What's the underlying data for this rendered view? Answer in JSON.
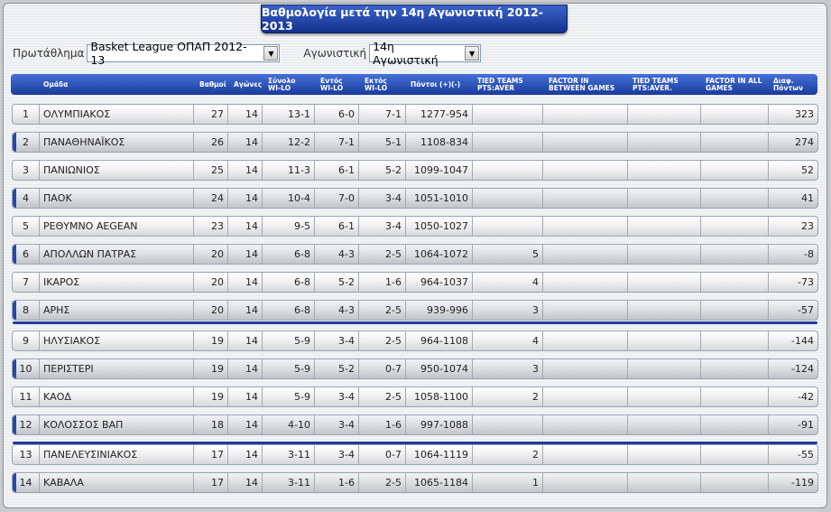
{
  "title": "Βαθμολογία μετά την 14η Αγωνιστική 2012-2013",
  "filters": {
    "league_label": "Πρωτάθλημα",
    "league_value": "Basket League ΟΠΑΠ 2012-13",
    "round_label": "Αγωνιστική",
    "round_value": "14η Αγωνιστική"
  },
  "columns": {
    "team": "Ομάδα",
    "points": "Βαθμοί",
    "games": "Αγώνες",
    "total_1": "Σύνολο",
    "total_2": "WI-LO",
    "home_1": "Εντός",
    "home_2": "WI-LO",
    "away_1": "Εκτός",
    "away_2": "WI-LO",
    "scores": "Πόντοι (+)(-)",
    "tied_pts_1": "TIED TEAMS",
    "tied_pts_2": "PTS:AVER",
    "factor_between_1": "FACTOR IN",
    "factor_between_2": "BETWEEN GAMES",
    "tied_aver_1": "TIED TEAMS",
    "tied_aver_2": "PTS:AVER.",
    "factor_all_1": "FACTOR IN ALL",
    "factor_all_2": "GAMES",
    "diff_1": "Διαφ.",
    "diff_2": "Πόντων"
  },
  "rows": [
    {
      "pos": "1",
      "team": "ΟΛΥΜΠΙΑΚΟΣ",
      "points": "27",
      "games": "14",
      "total": "13-1",
      "home": "6-0",
      "away": "7-1",
      "scores": "1277-954",
      "tied": "",
      "diff": "323"
    },
    {
      "pos": "2",
      "team": "ΠΑΝΑΘΗΝΑΪΚΟΣ",
      "points": "26",
      "games": "14",
      "total": "12-2",
      "home": "7-1",
      "away": "5-1",
      "scores": "1108-834",
      "tied": "",
      "diff": "274"
    },
    {
      "pos": "3",
      "team": "ΠΑΝΙΩΝΙΟΣ",
      "points": "25",
      "games": "14",
      "total": "11-3",
      "home": "6-1",
      "away": "5-2",
      "scores": "1099-1047",
      "tied": "",
      "diff": "52"
    },
    {
      "pos": "4",
      "team": "ΠΑΟΚ",
      "points": "24",
      "games": "14",
      "total": "10-4",
      "home": "7-0",
      "away": "3-4",
      "scores": "1051-1010",
      "tied": "",
      "diff": "41"
    },
    {
      "pos": "5",
      "team": "ΡΕΘΥΜΝΟ AEGEAN",
      "points": "23",
      "games": "14",
      "total": "9-5",
      "home": "6-1",
      "away": "3-4",
      "scores": "1050-1027",
      "tied": "",
      "diff": "23"
    },
    {
      "pos": "6",
      "team": "ΑΠΟΛΛΩΝ ΠΑΤΡΑΣ",
      "points": "20",
      "games": "14",
      "total": "6-8",
      "home": "4-3",
      "away": "2-5",
      "scores": "1064-1072",
      "tied": "5",
      "diff": "-8"
    },
    {
      "pos": "7",
      "team": "ΙΚΑΡΟΣ",
      "points": "20",
      "games": "14",
      "total": "6-8",
      "home": "5-2",
      "away": "1-6",
      "scores": "964-1037",
      "tied": "4",
      "diff": "-73"
    },
    {
      "pos": "8",
      "team": "ΑΡΗΣ",
      "points": "20",
      "games": "14",
      "total": "6-8",
      "home": "4-3",
      "away": "2-5",
      "scores": "939-996",
      "tied": "3",
      "diff": "-57"
    },
    {
      "pos": "9",
      "team": "ΗΛΥΣΙΑΚΟΣ",
      "points": "19",
      "games": "14",
      "total": "5-9",
      "home": "3-4",
      "away": "2-5",
      "scores": "964-1108",
      "tied": "4",
      "diff": "-144"
    },
    {
      "pos": "10",
      "team": "ΠΕΡΙΣΤΕΡΙ",
      "points": "19",
      "games": "14",
      "total": "5-9",
      "home": "5-2",
      "away": "0-7",
      "scores": "950-1074",
      "tied": "3",
      "diff": "-124"
    },
    {
      "pos": "11",
      "team": "ΚΑΟΔ",
      "points": "19",
      "games": "14",
      "total": "5-9",
      "home": "3-4",
      "away": "2-5",
      "scores": "1058-1100",
      "tied": "2",
      "diff": "-42"
    },
    {
      "pos": "12",
      "team": "ΚΟΛΟΣΣΟΣ ΒΑΠ",
      "points": "18",
      "games": "14",
      "total": "4-10",
      "home": "3-4",
      "away": "1-6",
      "scores": "997-1088",
      "tied": "",
      "diff": "-91"
    },
    {
      "pos": "13",
      "team": "ΠΑΝΕΛΕΥΣΙΝΙΑΚΟΣ",
      "points": "17",
      "games": "14",
      "total": "3-11",
      "home": "3-4",
      "away": "0-7",
      "scores": "1064-1119",
      "tied": "2",
      "diff": "-55"
    },
    {
      "pos": "14",
      "team": "ΚΑΒΑΛΑ",
      "points": "17",
      "games": "14",
      "total": "3-11",
      "home": "1-6",
      "away": "2-5",
      "scores": "1065-1184",
      "tied": "1",
      "diff": "-119"
    }
  ],
  "colors": {
    "header_top": "#4470d6",
    "header_bottom": "#1a3b9c",
    "separator": "#1f3d9a"
  }
}
